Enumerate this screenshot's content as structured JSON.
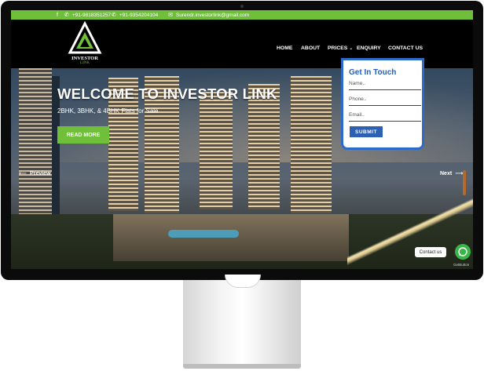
{
  "topbar": {
    "phone1": "+91-9818351257",
    "phone2": "+91-9354204104",
    "email": "Surendr.investorlink@gmail.com",
    "social_icon": "facebook-icon",
    "phone_icon": "phone-icon",
    "email_icon": "envelope-icon"
  },
  "brand": {
    "name": "INVESTOR",
    "sub": "LINK"
  },
  "nav": {
    "home": "HOME",
    "about": "ABOUT",
    "prices": "PRICES",
    "enquiry": "ENQUIRY",
    "contact": "CONTACT US"
  },
  "hero": {
    "title": "WELCOME TO INVESTOR LINK",
    "subtitle": "2BHK, 3BHK, & 4BHK Flats for Sale",
    "cta": "READ MORE",
    "prev": "Preview",
    "next": "Next"
  },
  "form": {
    "title": "Get In Touch",
    "name_placeholder": "Name..",
    "phone_placeholder": "Phone..",
    "email_placeholder": "Email..",
    "submit": "SUBMIT"
  },
  "widget": {
    "contact_label": "Contact us",
    "credit": "GetButton"
  },
  "colors": {
    "accent_green": "#6fbf3a",
    "form_blue": "#2d6bc9",
    "whatsapp_green": "#3bb54a"
  }
}
